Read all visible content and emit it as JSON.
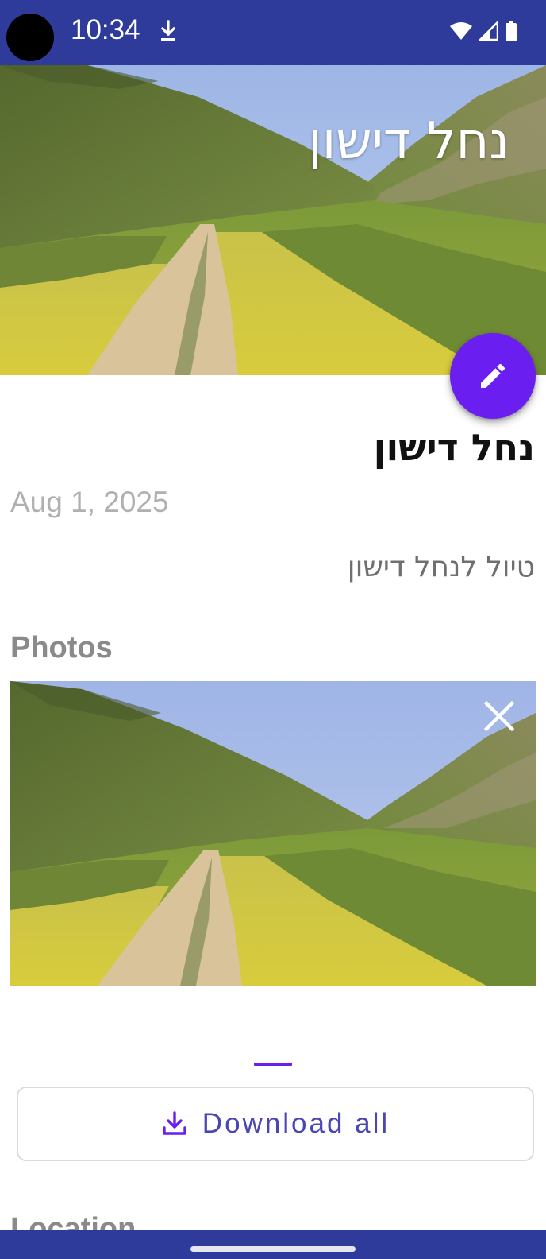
{
  "status_bar": {
    "time": "10:34",
    "icons": [
      "download-indicator-icon",
      "wifi-icon",
      "cellular-signal-icon",
      "battery-icon"
    ],
    "background_color": "#2f3b9b"
  },
  "hero": {
    "title": "נחל דישון",
    "image": "landscape-photo-dirt-path-valley"
  },
  "fab": {
    "icon": "pencil-icon",
    "color": "#6a1ff0"
  },
  "trip": {
    "title": "נחל דישון",
    "date": "Aug 1, 2025",
    "description": "טיול לנחל דישון"
  },
  "photos": {
    "heading": "Photos",
    "remove_icon": "close-icon",
    "current_index": 1,
    "total": 1
  },
  "actions": {
    "download_all_label": "Download all",
    "download_icon": "download-icon",
    "accent_color": "#4a46b4"
  },
  "location": {
    "heading": "Location"
  }
}
